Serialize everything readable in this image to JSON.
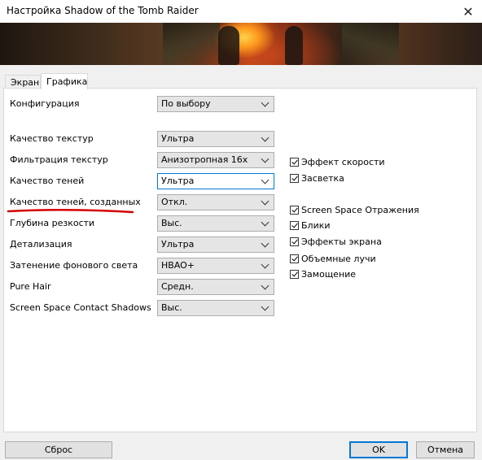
{
  "window": {
    "title": "Настройка Shadow of the Tomb Raider",
    "close": "✕"
  },
  "tabs": [
    {
      "label": "Экран",
      "active": false
    },
    {
      "label": "Графика",
      "active": true
    }
  ],
  "settings": [
    {
      "label": "Конфигурация",
      "value": "По выбору"
    },
    {
      "label": "Качество текстур",
      "value": "Ультра"
    },
    {
      "label": "Фильтрация текстур",
      "value": "Анизотропная 16x"
    },
    {
      "label": "Качество теней",
      "value": "Ультра"
    },
    {
      "label": "Качество теней, созданных",
      "value": "Откл."
    },
    {
      "label": "Глубина резкости",
      "value": "Выс."
    },
    {
      "label": "Детализация",
      "value": "Ультра"
    },
    {
      "label": "Затенение фонового света",
      "value": "HBAO+"
    },
    {
      "label": "Pure Hair",
      "value": "Средн."
    },
    {
      "label": "Screen Space Contact Shadows",
      "value": "Выс."
    }
  ],
  "checkboxes": [
    {
      "label": "Эффект скорости",
      "checked": true
    },
    {
      "label": "Засветка",
      "checked": true
    },
    {
      "label": "Screen Space Отражения",
      "checked": true
    },
    {
      "label": "Блики",
      "checked": true
    },
    {
      "label": "Эффекты экрана",
      "checked": true
    },
    {
      "label": "Объемные лучи",
      "checked": true
    },
    {
      "label": "Замощение",
      "checked": true
    }
  ],
  "buttons": {
    "reset": "Сброс",
    "ok": "OK",
    "cancel": "Отмена"
  },
  "colors": {
    "annotation": "#d40000",
    "accent": "#0078d7"
  }
}
